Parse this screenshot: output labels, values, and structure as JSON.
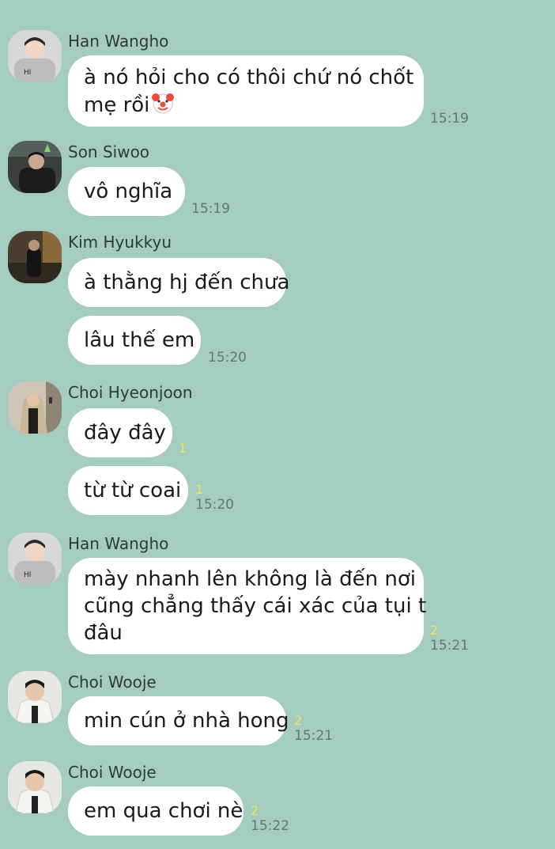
{
  "messages": [
    {
      "sender": "Han Wangho",
      "text_lines": [
        "à nó hỏi cho có thôi chứ nó chốt",
        "mẹ rồi"
      ],
      "emoji": "clown-face",
      "time": "15:19"
    },
    {
      "sender": "Son Siwoo",
      "text_lines": [
        "vô nghĩa"
      ],
      "time": "15:19"
    },
    {
      "sender": "Kim Hyukkyu",
      "text_lines": [
        "à thằng hj đến chưa"
      ]
    },
    {
      "text_lines": [
        "lâu thế em"
      ],
      "time": "15:20"
    },
    {
      "sender": "Choi Hyeonjoon",
      "text_lines": [
        "đây đây"
      ],
      "unread": "1"
    },
    {
      "text_lines": [
        "từ từ coai"
      ],
      "unread": "1",
      "time": "15:20"
    },
    {
      "sender": "Han Wangho",
      "text_lines": [
        "mày nhanh lên không là đến nơi",
        "cũng chẳng thấy cái xác của tụi t",
        "đâu"
      ],
      "unread": "2",
      "time": "15:21"
    },
    {
      "sender": "Choi Wooje",
      "text_lines": [
        "min cún ở nhà hong"
      ],
      "unread": "2",
      "time": "15:21"
    },
    {
      "sender": "Choi Wooje",
      "text_lines": [
        "em qua chơi nè"
      ],
      "unread": "2",
      "time": "15:22"
    }
  ],
  "colors": {
    "background": "#a5cdbf",
    "bubble": "#ffffff",
    "unread": "#f2e35e",
    "time": "#5f7a72"
  }
}
